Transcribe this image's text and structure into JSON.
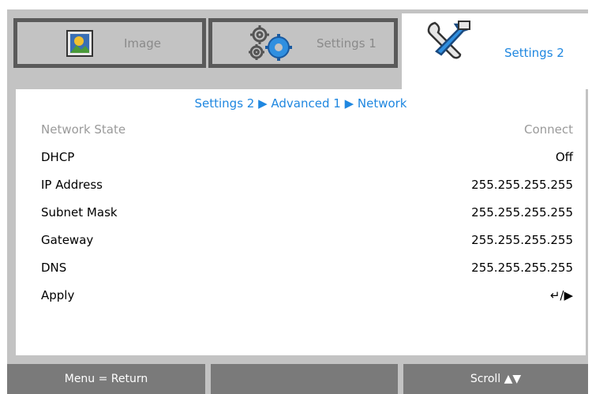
{
  "tabs": {
    "image": {
      "label": "Image",
      "icon": "image-icon"
    },
    "settings1": {
      "label": "Settings 1",
      "icon": "gears-icon"
    },
    "settings2": {
      "label": "Settings 2",
      "icon": "tools-icon"
    }
  },
  "breadcrumb": "Settings 2 ▶ Advanced 1 ▶ Network",
  "rows": [
    {
      "label": "Network State",
      "value": "Connect",
      "enabled": false
    },
    {
      "label": "DHCP",
      "value": "Off",
      "enabled": true
    },
    {
      "label": "IP Address",
      "value": "255.255.255.255",
      "enabled": true
    },
    {
      "label": "Subnet Mask",
      "value": "255.255.255.255",
      "enabled": true
    },
    {
      "label": "Gateway",
      "value": "255.255.255.255",
      "enabled": true
    },
    {
      "label": "DNS",
      "value": "255.255.255.255",
      "enabled": true
    },
    {
      "label": "Apply",
      "value": "↵/▶",
      "enabled": true
    }
  ],
  "footer": {
    "left": "Menu = Return",
    "middle": "",
    "right": "Scroll ▲▼"
  },
  "colors": {
    "frame": "#c3c3c3",
    "accent": "#1f87e0",
    "footer": "#7a7a7a"
  }
}
